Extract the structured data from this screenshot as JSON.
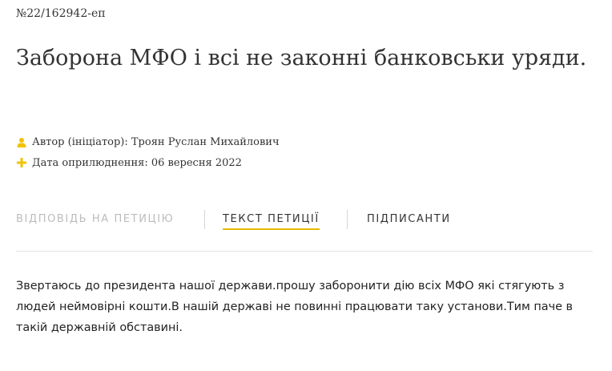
{
  "petition": {
    "number": "№22/162942-еп",
    "title": "Заборона МФО і всі не законні банковськи уряди.",
    "author": "Автор (ініціатор): Троян Руслан Михайлович",
    "date": "Дата оприлюднення: 06 вересня 2022",
    "body": "Звертаюсь до президента нашої держави.прошу заборонити дію всіх МФО які стягують з людей неймовірні кошти.В нашій державі не повинні працювати таку установи.Тим паче в такій державній обставині."
  },
  "tabs": {
    "answer": "Відповідь на петицію",
    "text": "Текст петиції",
    "signers": "Підписанти"
  },
  "colors": {
    "accent": "#e6b800",
    "icon": "#f2c200",
    "inactive_tab": "#bcbcbc"
  },
  "icons": {
    "author": "user-icon",
    "date": "plus-icon"
  }
}
